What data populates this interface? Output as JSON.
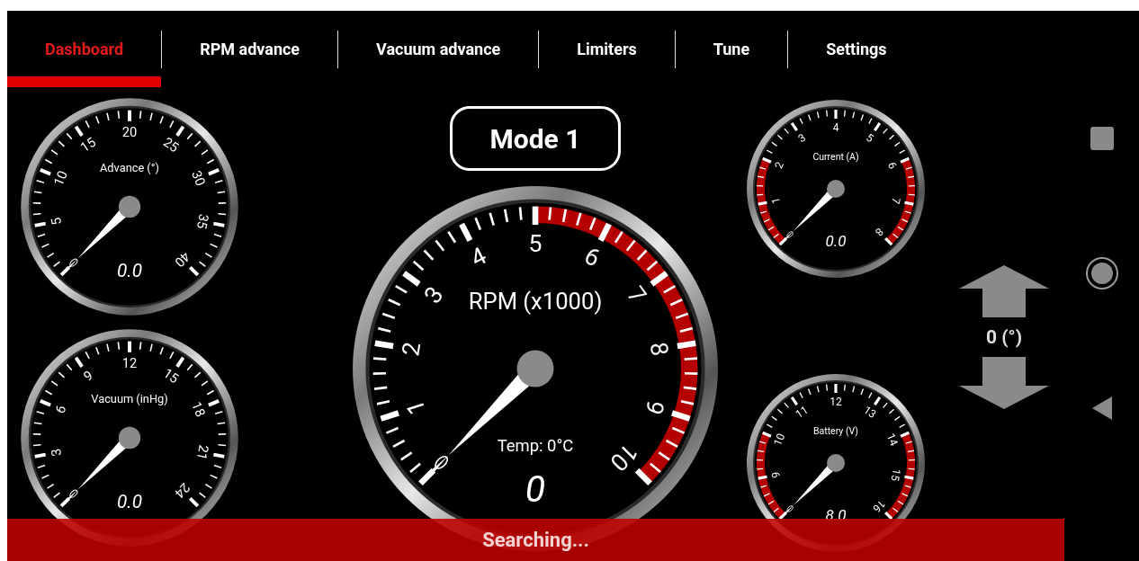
{
  "tabs": [
    {
      "label": "Dashboard",
      "selected": true
    },
    {
      "label": "RPM advance",
      "selected": false
    },
    {
      "label": "Vacuum advance",
      "selected": false
    },
    {
      "label": "Limiters",
      "selected": false
    },
    {
      "label": "Tune",
      "selected": false
    },
    {
      "label": "Settings",
      "selected": false
    }
  ],
  "left_gauges": [
    {
      "title": "Advance (°)",
      "readout": "0.0",
      "labels": [
        {
          "text": "5",
          "redline": false
        },
        {
          "text": "10",
          "redline": false
        },
        {
          "text": "15",
          "redline": false
        },
        {
          "text": "20",
          "redline": false
        },
        {
          "text": "25",
          "redline": false
        },
        {
          "text": "30",
          "redline": false
        },
        {
          "text": "35",
          "redline": false
        },
        {
          "text": "40",
          "redline": false
        }
      ]
    },
    {
      "title": "Vacuum  (inHg)",
      "readout": "0.0",
      "labels": [
        {
          "text": "3",
          "redline": false
        },
        {
          "text": "6",
          "redline": false
        },
        {
          "text": "9",
          "redline": false
        },
        {
          "text": "12",
          "redline": false
        },
        {
          "text": "15",
          "redline": false
        },
        {
          "text": "18",
          "redline": false
        },
        {
          "text": "21",
          "redline": false
        },
        {
          "text": "24",
          "redline": false
        }
      ]
    }
  ],
  "mode_button": {
    "label": "Mode 1"
  },
  "main_gauge": {
    "title": "RPM (x1000)",
    "subtitle": "Temp: 0°C",
    "readout": "0",
    "labels": [
      {
        "text": "1",
        "redline": false
      },
      {
        "text": "2",
        "redline": false
      },
      {
        "text": "3",
        "redline": false
      },
      {
        "text": "4",
        "redline": false
      },
      {
        "text": "5",
        "redline": false
      },
      {
        "text": "6",
        "redline": true
      },
      {
        "text": "7",
        "redline": true
      },
      {
        "text": "8",
        "redline": true
      },
      {
        "text": "9",
        "redline": true
      },
      {
        "text": "10",
        "redline": true
      }
    ]
  },
  "right_gauges": [
    {
      "title": "Current (A)",
      "readout": "0.0",
      "labels": [
        {
          "text": "1",
          "redline": true
        },
        {
          "text": "2",
          "redline": true
        },
        {
          "text": "3",
          "redline": false
        },
        {
          "text": "4",
          "redline": false
        },
        {
          "text": "5",
          "redline": false
        },
        {
          "text": "6",
          "redline": false
        },
        {
          "text": "7",
          "redline": true
        },
        {
          "text": "8",
          "redline": true
        }
      ]
    },
    {
      "title": "Battery (V)",
      "readout": "8.0",
      "labels": [
        {
          "text": "9",
          "redline": true
        },
        {
          "text": "10",
          "redline": true
        },
        {
          "text": "11",
          "redline": false
        },
        {
          "text": "12",
          "redline": false
        },
        {
          "text": "13",
          "redline": false
        },
        {
          "text": "14",
          "redline": false
        },
        {
          "text": "15",
          "redline": true
        },
        {
          "text": "16",
          "redline": true
        }
      ]
    }
  ],
  "offset_control": {
    "value": "0 (°)"
  },
  "snackbar": {
    "message": "Searching..."
  }
}
